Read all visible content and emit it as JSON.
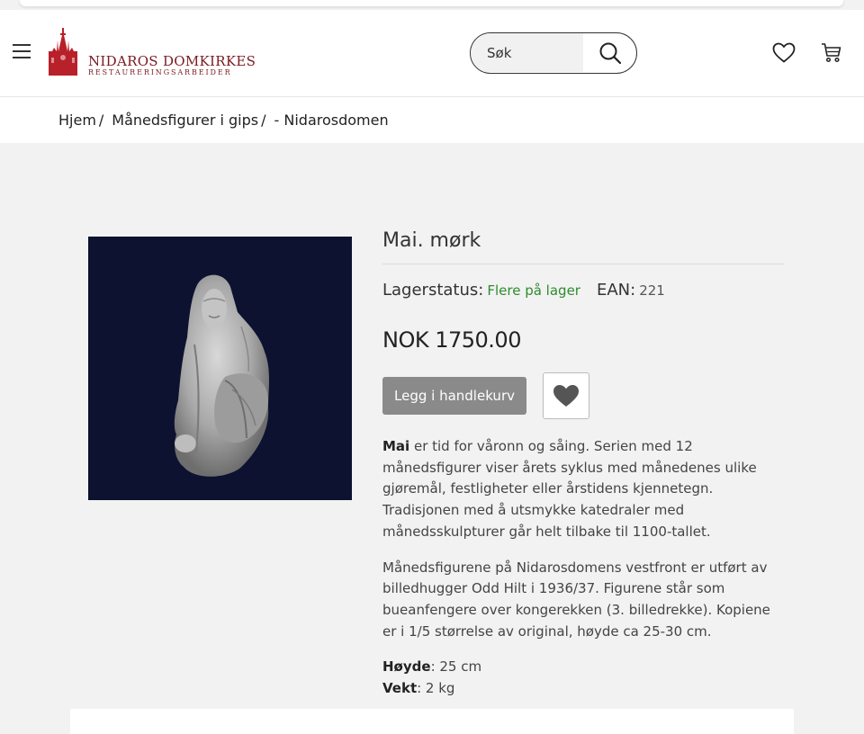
{
  "header": {
    "logo_name": "NIDAROS DOMKIRKES",
    "logo_sub": "RESTAURERINGSARBEIDER",
    "search_placeholder": "Søk",
    "brand_color": "#7a1a1f"
  },
  "breadcrumb": [
    {
      "label": "Hjem",
      "sep": "/"
    },
    {
      "label": "Månedsfigurer i gips",
      "sep": "/"
    },
    {
      "label": "- Nidarosdomen",
      "sep": ""
    }
  ],
  "product": {
    "title": "Mai. mørk",
    "stock_label": "Lagerstatus:",
    "stock_value": "Flere på lager",
    "ean_label": "EAN:",
    "ean_value": "221",
    "price": "NOK 1750.00",
    "add_to_cart": "Legg i handlekurv",
    "desc_lead": "Mai",
    "desc_p1": " er tid for våronn og såing. Serien med 12 månedsfigurer viser årets syklus med månedenes ulike gjøremål, festligheter eller årstidens kjennetegn. Tradisjonen med å utsmykke katedraler med månedsskulpturer går helt tilbake til 1100-tallet.",
    "desc_p2": "Månedsfigurene på Nidarosdomens vestfront er utført av billedhugger Odd Hilt i 1936/37. Figurene står som bueanfengere over kongerekken (3. billedrekke). Kopiene er i 1/5 størrelse av original, høyde ca 25-30 cm.",
    "height_label": "Høyde",
    "height_value": ": 25 cm",
    "weight_label": "Vekt",
    "weight_value": ": 2 kg",
    "stock_color": "#2e8b2e",
    "button_color": "#8a8a8a"
  }
}
